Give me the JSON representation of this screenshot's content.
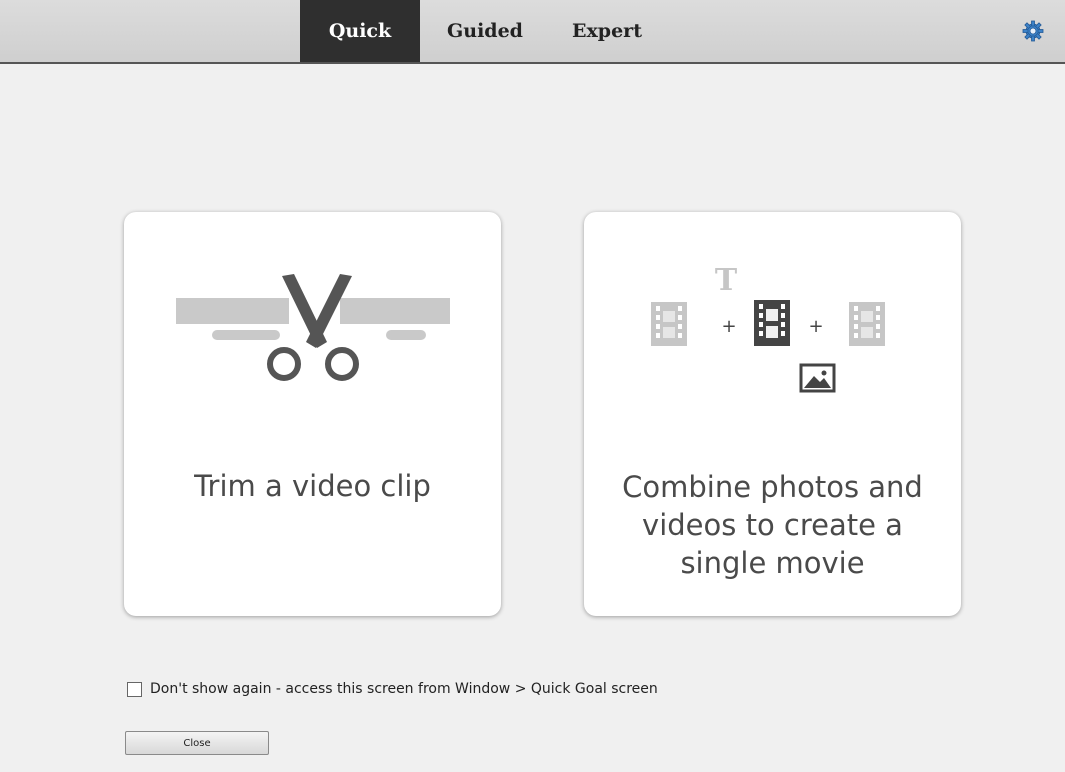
{
  "tabs": {
    "quick": "Quick",
    "guided": "Guided",
    "expert": "Expert",
    "active": "Quick"
  },
  "settings_icon": "gear-icon",
  "cards": {
    "trim": {
      "label": "Trim a video clip",
      "icon": "scissors-icon"
    },
    "combine": {
      "label_lines": [
        "Combine photos and",
        "videos to create a",
        "single movie"
      ],
      "icons": [
        "title-text-icon",
        "film-clip-icon",
        "plus-icon",
        "film-clip-icon",
        "plus-icon",
        "film-clip-icon",
        "photo-icon"
      ],
      "plus": "+",
      "text_glyph": "T"
    }
  },
  "footer": {
    "dont_show_checked": false,
    "dont_show_label": "Don't show again - access this screen from Window > Quick Goal screen",
    "close_label": "Close"
  },
  "colors": {
    "topbar": "#d5d5d5",
    "active_tab": "#2f2f2f",
    "card": "#ffffff",
    "background": "#f0f0f0",
    "icon_gray": "#bdbdbd",
    "icon_dark": "#4a4a4a",
    "gear": "#3c82c8"
  }
}
